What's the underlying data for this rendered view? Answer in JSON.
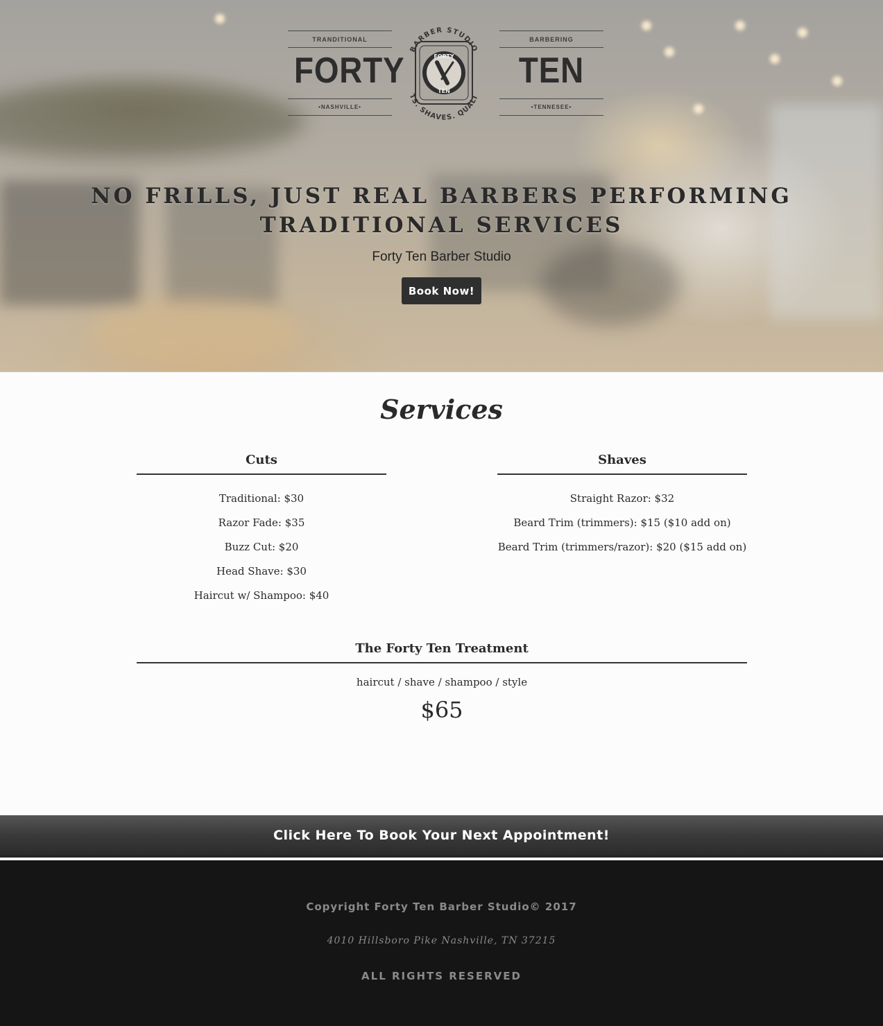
{
  "logo": {
    "left_tag": "TRANDITIONAL",
    "left_word": "FORTY",
    "left_city": "•NASHVILLE•",
    "right_tag": "BARBERING",
    "right_word": "TEN",
    "right_state": "•TENNESEE•",
    "arc_top": "BARBER STUDIO",
    "arc_bottom": "CUTS. SHAVES. QUALITY.",
    "emblem_top": "FORTY",
    "emblem_bottom": "TEN"
  },
  "hero": {
    "headline_line1": "NO FRILLS, JUST REAL BARBERS PERFORMING",
    "headline_line2": "TRADITIONAL SERVICES",
    "subhead": "Forty Ten Barber Studio",
    "button_label": "Book Now!"
  },
  "services": {
    "title": "Services",
    "cuts": {
      "title": "Cuts",
      "items": [
        "Traditional: $30",
        "Razor Fade: $35",
        "Buzz Cut: $20",
        "Head Shave: $30",
        "Haircut w/ Shampoo: $40"
      ]
    },
    "shaves": {
      "title": "Shaves",
      "items": [
        "Straight Razor: $32",
        "Beard Trim (trimmers): $15 ($10 add on)",
        "Beard Trim (trimmers/razor): $20 ($15 add on)"
      ]
    },
    "treatment": {
      "title": "The Forty Ten Treatment",
      "description": "haircut / shave / shampoo / style",
      "price": "$65"
    }
  },
  "book_bar": {
    "label": "Click Here To Book Your Next Appointment!"
  },
  "footer": {
    "copyright": "Copyright Forty Ten Barber Studio© 2017",
    "address": "4010 Hillsboro Pike Nashville, TN 37215",
    "rights": "ALL RIGHTS RESERVED"
  },
  "colors": {
    "dark_button": "#2f2f2f",
    "footer_bg": "#151515",
    "footer_text": "#8a8a8a"
  }
}
